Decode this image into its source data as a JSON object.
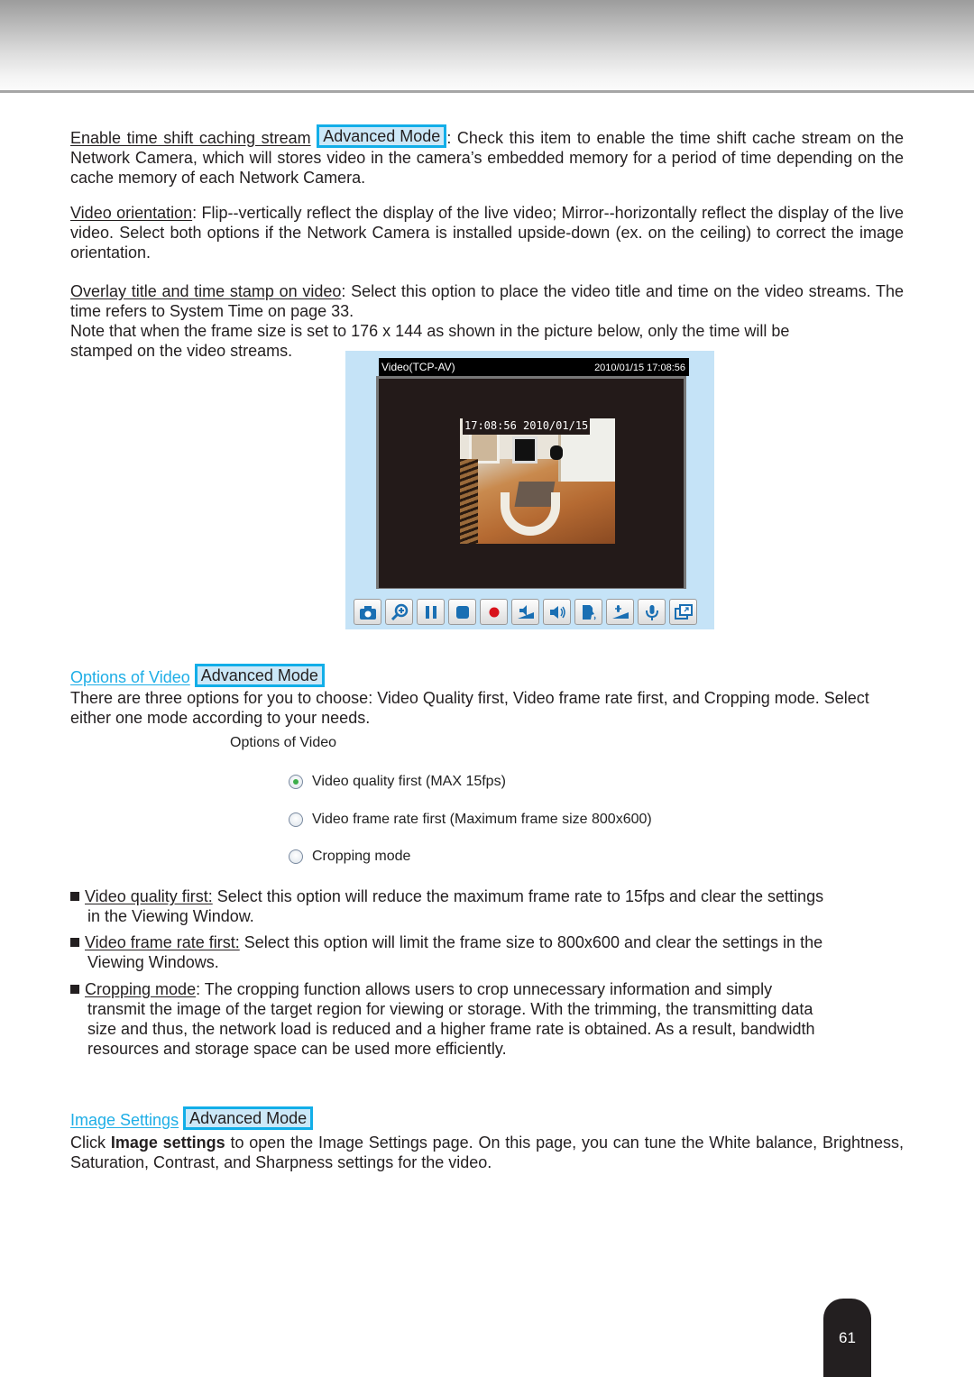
{
  "sections": {
    "time_shift": {
      "term": "Enable time shift caching stream",
      "badge": "Advanced Mode",
      "text_line1": ": Check this item to enable the time shift cache",
      "text_rest": "stream on the Network Camera, which will stores video in the camera’s embedded memory for a period of time depending on the cache memory of each Network Camera."
    },
    "orientation": {
      "term": "Video orientation",
      "text": ": Flip--vertically reflect the display of the live video; Mirror--horizontally reflect the display of the live video. Select both options if the Network Camera is installed upside-down (ex. on the ceiling) to correct the image orientation."
    },
    "overlay": {
      "term": "Overlay title and time stamp on video",
      "text": ": Select this option to place the video title and time on the video streams. The time refers to System Time on page 33.",
      "note_line1": "Note that when the frame size is set to 176 x 144 as shown in the picture below, only the time will be",
      "note_line2": "stamped on the video streams."
    },
    "options_of_video": {
      "link": "Options of Video",
      "badge": "Advanced Mode",
      "text": "There are three options for you to choose: Video Quality first, Video frame rate first, and Cropping mode. Select either one mode according to your needs."
    },
    "image_settings": {
      "link": "Image Settings",
      "badge": "Advanced Mode",
      "text_prefix": "Click ",
      "text_bold": "Image settings",
      "text_suffix": " to open the Image Settings page. On this page, you can tune the White balance, Brightness, Saturation, Contrast, and Sharpness settings for the video."
    }
  },
  "viewer": {
    "title": "Video(TCP-AV)",
    "datetime": "2010/01/15 17:08:56",
    "overlay_stamp": "17:08:56 2010/01/15",
    "toolbar": [
      {
        "name": "snapshot",
        "icon": "camera-icon"
      },
      {
        "name": "digital-zoom",
        "icon": "zoom-in-icon"
      },
      {
        "name": "pause",
        "icon": "pause-icon"
      },
      {
        "name": "stop",
        "icon": "stop-icon"
      },
      {
        "name": "record",
        "icon": "record-icon"
      },
      {
        "name": "volume",
        "icon": "volume-icon"
      },
      {
        "name": "mute",
        "icon": "speaker-icon"
      },
      {
        "name": "talk",
        "icon": "talk-icon"
      },
      {
        "name": "mic-volume",
        "icon": "mic-volume-icon"
      },
      {
        "name": "mic",
        "icon": "microphone-icon"
      },
      {
        "name": "fullscreen",
        "icon": "fullscreen-icon"
      }
    ]
  },
  "options_panel": {
    "title": "Options of Video",
    "options": [
      {
        "label": "Video quality first (MAX 15fps)",
        "checked": true
      },
      {
        "label": "Video frame rate first (Maximum frame size 800x600)",
        "checked": false
      },
      {
        "label": "Cropping mode",
        "checked": false
      }
    ]
  },
  "bullets": [
    {
      "term": "Video quality first:",
      "line1": " Select this option will reduce the maximum frame rate to 15fps and clear the settings",
      "cont": [
        "in the Viewing Window."
      ]
    },
    {
      "term": "Video frame rate first:",
      "line1": " Select this option will limit the frame size to 800x600 and clear the settings in the",
      "cont": [
        "Viewing Windows."
      ]
    },
    {
      "term": "Cropping mode",
      "line1": ": The cropping function allows users to crop unnecessary information and simply",
      "cont": [
        "transmit the image of the target region for viewing or storage. With the trimming, the transmitting data",
        "size and thus, the network load is reduced and a higher frame rate is obtained. As a result, bandwidth",
        "resources and storage space can be used more efficiently."
      ]
    }
  ],
  "page_number": "61",
  "colors": {
    "link": "#1eaee6",
    "badge_border": "#12aee8",
    "badge_fill": "#cce8f8",
    "viewer_bg": "#c5e3f7"
  }
}
